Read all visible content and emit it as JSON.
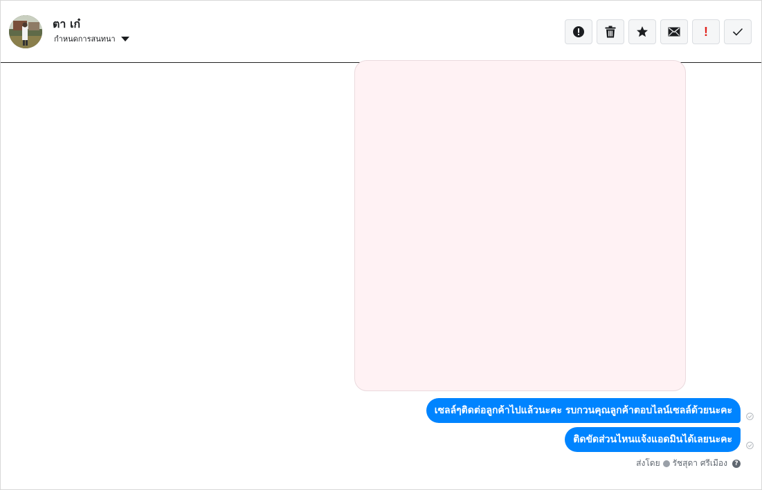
{
  "header": {
    "contact_name": "ตา เก๋",
    "conversation_select_label": "กำหนดการสนทนา",
    "toolbar": [
      {
        "name": "report-spam-button",
        "icon": "exclamation-circle-icon"
      },
      {
        "name": "delete-button",
        "icon": "trash-icon"
      },
      {
        "name": "star-button",
        "icon": "star-icon"
      },
      {
        "name": "mark-unread-button",
        "icon": "envelope-icon"
      },
      {
        "name": "mark-important-button",
        "icon": "exclamation-icon",
        "text": "!",
        "color": "#e0201a"
      },
      {
        "name": "mark-done-button",
        "icon": "checkmark-icon"
      }
    ]
  },
  "messages": [
    {
      "text": "เซลล์ๆติดต่อลูกค้าไปแล้วนะคะ รบกวนคุณลูกค้าตอบไลน์เซลล์ด้วยนะคะ",
      "status": "seen"
    },
    {
      "text": "ติดขัดส่วนไหนแจ้งแอดมินได้เลยนะคะ",
      "status": "seen"
    }
  ],
  "attachment": {
    "type": "image",
    "background": "#fff2f4"
  },
  "sent_by": {
    "prefix": "ส่งโดย",
    "agent_name": "รัชสุดา ศรีเมือง",
    "help_icon": "?"
  },
  "colors": {
    "bubble": "#0084ff",
    "bubble_text": "#ffffff",
    "important": "#e0201a"
  }
}
